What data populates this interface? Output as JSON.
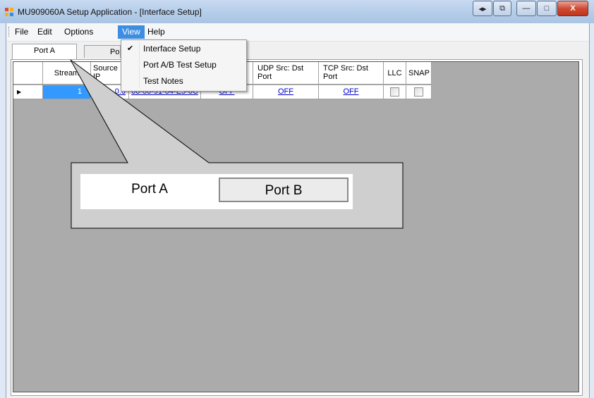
{
  "window": {
    "title": "MU909060A Setup Application - [Interface Setup]",
    "caption_buttons": [
      "◂▸",
      "⧉",
      "—",
      "□",
      "X"
    ]
  },
  "menu": {
    "items": [
      {
        "label": "File"
      },
      {
        "label": "Edit"
      },
      {
        "label": "Options"
      },
      {
        "label": "View"
      },
      {
        "label": "Help"
      }
    ],
    "active": "View"
  },
  "view_menu": {
    "items": [
      {
        "label": "Interface Setup",
        "checked": true
      },
      {
        "label": "Port A/B Test Setup",
        "checked": false
      },
      {
        "label": "Test Notes",
        "checked": false
      }
    ],
    "check_glyph": "✔"
  },
  "tabs": [
    {
      "label": "Port A",
      "selected": true
    },
    {
      "label": "Port B",
      "visible_text": "Por",
      "selected": false
    }
  ],
  "grid": {
    "columns": [
      {
        "label": "Stream"
      },
      {
        "label": "Source IP"
      },
      {
        "label": ""
      },
      {
        "label": ""
      },
      {
        "label": "UDP Src: Dst Port"
      },
      {
        "label": "TCP Src: Dst Port"
      },
      {
        "label": "LLC"
      },
      {
        "label": "SNAP"
      }
    ],
    "rows": [
      {
        "indicator": "▶",
        "stream": "1",
        "source_ip": "0.0",
        "mac": "00-00-91-04-E5-0C",
        "vlan": "OFF",
        "udp": "OFF",
        "tcp": "OFF",
        "llc": false,
        "snap": false
      }
    ]
  },
  "callout": {
    "tab_a": "Port A",
    "tab_b": "Port B"
  },
  "colors": {
    "accent": "#3d8ee0",
    "grid_background": "#ababab",
    "selected_cell": "#3399ff",
    "link": "#0000cc"
  }
}
